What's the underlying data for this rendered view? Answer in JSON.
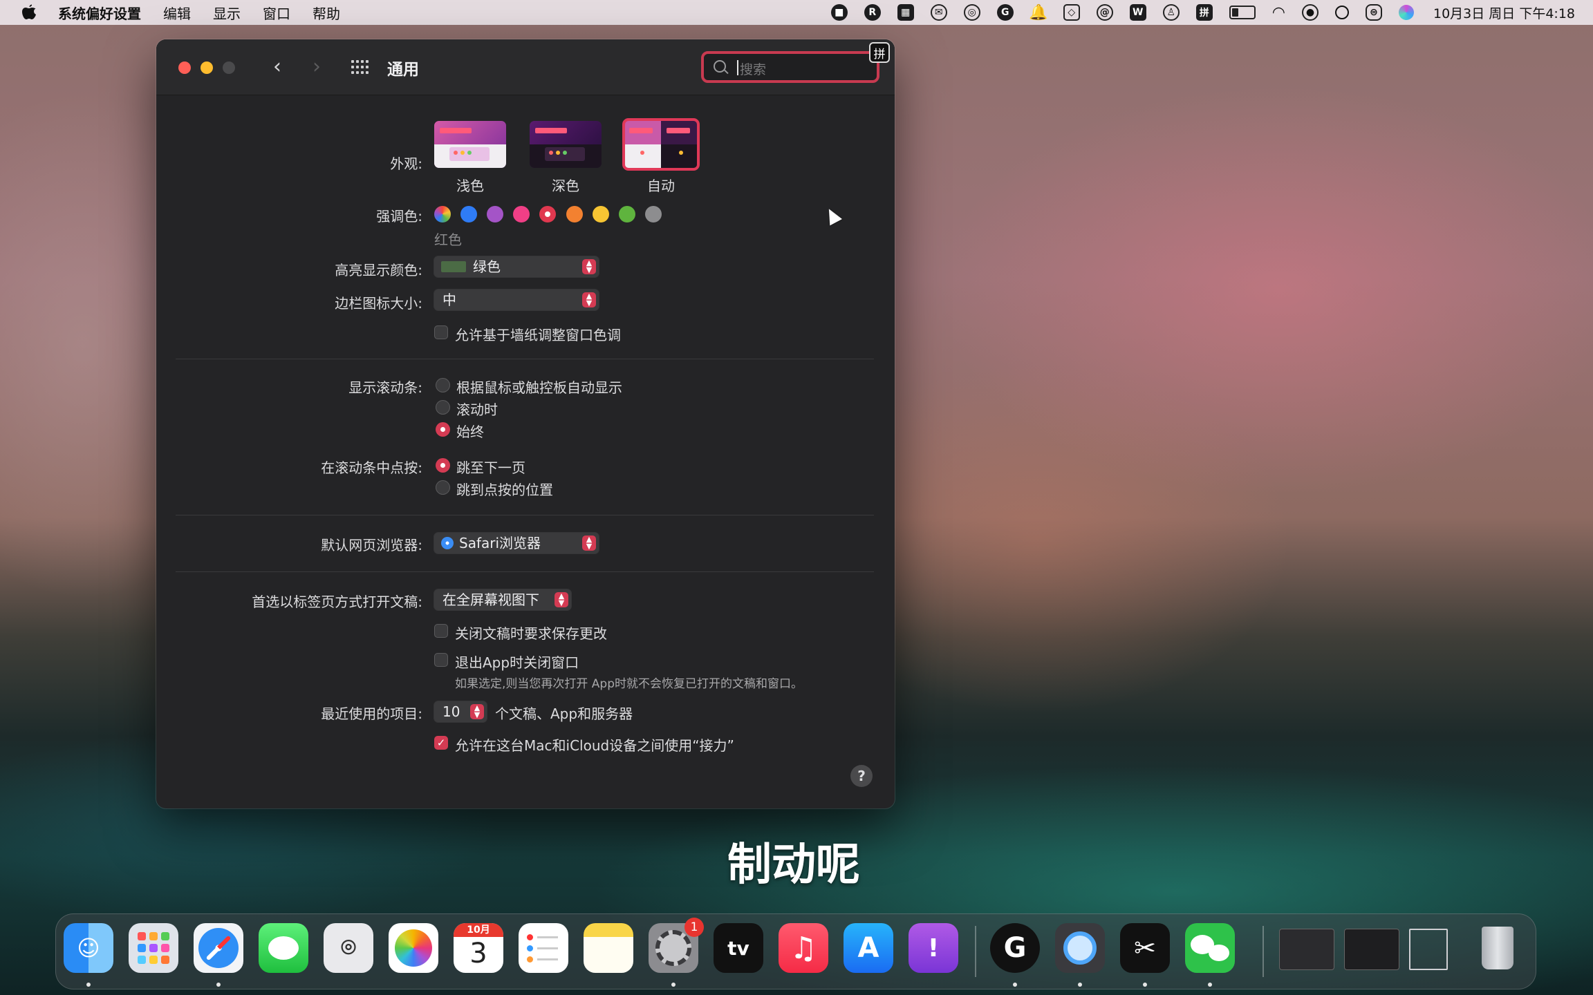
{
  "menubar": {
    "app_name": "系统偏好设置",
    "items": [
      "编辑",
      "显示",
      "窗口",
      "帮助"
    ],
    "clock": "10月3日 周日 下午4:18"
  },
  "window": {
    "title": "通用",
    "search_placeholder": "搜索",
    "ime_indicator": "拼"
  },
  "appearance": {
    "label": "外观:",
    "options": [
      "浅色",
      "深色",
      "自动"
    ],
    "selected": "自动"
  },
  "accent": {
    "label": "强调色:",
    "selected_name": "红色",
    "colors": [
      "multicolor",
      "#2f7cf6",
      "#a454c7",
      "#f03f86",
      "#e0384f",
      "#f38130",
      "#f7c533",
      "#5fb43e",
      "#8d8d8f"
    ],
    "selected_index": 4
  },
  "highlight": {
    "label": "高亮显示颜色:",
    "value": "绿色",
    "swatch": "#4b6b45"
  },
  "sidebar_icon_size": {
    "label": "边栏图标大小:",
    "value": "中"
  },
  "wallpaper_tint": {
    "label": "允许基于墙纸调整窗口色调",
    "checked": false
  },
  "show_scrollbars": {
    "label": "显示滚动条:",
    "options": [
      "根据鼠标或触控板自动显示",
      "滚动时",
      "始终"
    ],
    "selected": "始终"
  },
  "click_scrollbar": {
    "label": "在滚动条中点按:",
    "options": [
      "跳至下一页",
      "跳到点按的位置"
    ],
    "selected": "跳至下一页"
  },
  "default_browser": {
    "label": "默认网页浏览器:",
    "value": "Safari浏览器"
  },
  "prefer_tabs": {
    "label": "首选以标签页方式打开文稿:",
    "value": "在全屏幕视图下"
  },
  "ask_save": {
    "label": "关闭文稿时要求保存更改",
    "checked": false
  },
  "close_windows": {
    "label": "退出App时关闭窗口",
    "checked": false,
    "note": "如果选定,则当您再次打开 App时就不会恢复已打开的文稿和窗口。"
  },
  "recent_items": {
    "label": "最近使用的项目:",
    "value": "10",
    "suffix": "个文稿、App和服务器"
  },
  "handoff": {
    "label": "允许在这台Mac和iCloud设备之间使用“接力”",
    "checked": true
  },
  "help_symbol": "?",
  "subtitle": "制动呢",
  "dock": {
    "calendar_month": "10月",
    "calendar_day": "3",
    "settings_badge": "1",
    "tv_label": "tv"
  }
}
